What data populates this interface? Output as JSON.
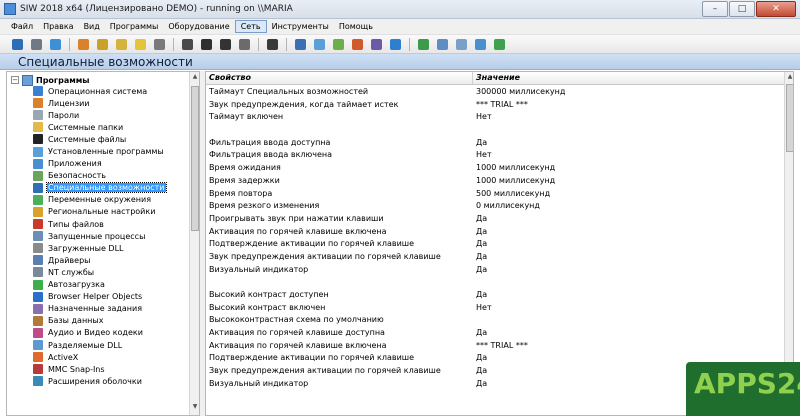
{
  "window": {
    "title": "SIW 2018 x64 (Лицензировано DEMO) - running on \\\\MARIA",
    "minimize": "–",
    "maximize": "□",
    "close": "✕"
  },
  "menu": [
    "Файл",
    "Правка",
    "Вид",
    "Программы",
    "Оборудование",
    "Сеть",
    "Инструменты",
    "Помощь"
  ],
  "toolbar_icons": [
    {
      "name": "save-icon",
      "color": "#2d6fb7"
    },
    {
      "name": "print-icon",
      "color": "#6f7a86"
    },
    {
      "name": "refresh-icon",
      "color": "#3f8ed8"
    },
    {
      "name": "sep"
    },
    {
      "name": "windows-icon",
      "color": "#d9822b"
    },
    {
      "name": "license-icon",
      "color": "#c9a227"
    },
    {
      "name": "key-icon",
      "color": "#d6b33a"
    },
    {
      "name": "bulb-icon",
      "color": "#e3c43a"
    },
    {
      "name": "service-icon",
      "color": "#7a7a7a"
    },
    {
      "name": "sep"
    },
    {
      "name": "cpu-icon",
      "color": "#4a4a4a"
    },
    {
      "name": "display-icon",
      "color": "#2f2f2f"
    },
    {
      "name": "disk-icon",
      "color": "#333333"
    },
    {
      "name": "memory-icon",
      "color": "#6b6b6b"
    },
    {
      "name": "sep"
    },
    {
      "name": "device-icon",
      "color": "#3a3a3a"
    },
    {
      "name": "sep"
    },
    {
      "name": "network-icon",
      "color": "#3b6fb5"
    },
    {
      "name": "monitor-icon",
      "color": "#5aa0d8"
    },
    {
      "name": "battery-icon",
      "color": "#6cae4a"
    },
    {
      "name": "sound-icon",
      "color": "#d05a2b"
    },
    {
      "name": "chip-icon",
      "color": "#6b5aa8"
    },
    {
      "name": "settings-icon",
      "color": "#2f7fd0"
    },
    {
      "name": "sep"
    },
    {
      "name": "share-icon",
      "color": "#3d9a4a"
    },
    {
      "name": "tools-icon",
      "color": "#5f8fc2"
    },
    {
      "name": "mail-icon",
      "color": "#7aa0c8"
    },
    {
      "name": "help-icon",
      "color": "#4a8fd0"
    },
    {
      "name": "money-icon",
      "color": "#3fa050"
    }
  ],
  "header": {
    "title": "Специальные возможности"
  },
  "tree": {
    "root_label": "Программы",
    "items": [
      {
        "label": "Операционная система",
        "icon": "os-icon",
        "color": "#3b7fd1"
      },
      {
        "label": "Лицензии",
        "icon": "license-icon",
        "color": "#d9822b"
      },
      {
        "label": "Пароли",
        "icon": "password-icon",
        "color": "#9aa7b5"
      },
      {
        "label": "Системные папки",
        "icon": "folder-icon",
        "color": "#e2b94a"
      },
      {
        "label": "Системные файлы",
        "icon": "dll-icon",
        "color": "#222222"
      },
      {
        "label": "Установленные программы",
        "icon": "programs-icon",
        "color": "#5aa0d8"
      },
      {
        "label": "Приложения",
        "icon": "apps-icon",
        "color": "#4a8fd0"
      },
      {
        "label": "Безопасность",
        "icon": "security-icon",
        "color": "#6aa35a"
      },
      {
        "label": "Специальные возможности",
        "icon": "accessibility-icon",
        "color": "#2f6fb8"
      },
      {
        "label": "Переменные окружения",
        "icon": "env-icon",
        "color": "#4fae5a"
      },
      {
        "label": "Региональные настройки",
        "icon": "region-icon",
        "color": "#d9a32b"
      },
      {
        "label": "Типы файлов",
        "icon": "file-types-icon",
        "color": "#c93a2b"
      },
      {
        "label": "Запущенные процессы",
        "icon": "process-icon",
        "color": "#6b8fb8"
      },
      {
        "label": "Загруженные DLL",
        "icon": "loaded-dll-icon",
        "color": "#8a8a8a"
      },
      {
        "label": "Драйверы",
        "icon": "driver-icon",
        "color": "#5a7fb0"
      },
      {
        "label": "NT службы",
        "icon": "nt-services-icon",
        "color": "#7a8a9a"
      },
      {
        "label": "Автозагрузка",
        "icon": "startup-icon",
        "color": "#3fae4a"
      },
      {
        "label": "Browser Helper Objects",
        "icon": "bho-icon",
        "color": "#2a6fc9"
      },
      {
        "label": "Назначенные задания",
        "icon": "tasks-icon",
        "color": "#8a6fb0"
      },
      {
        "label": "Базы данных",
        "icon": "database-icon",
        "color": "#b07a3a"
      },
      {
        "label": "Аудио и Видео кодеки",
        "icon": "codec-icon",
        "color": "#c04a8a"
      },
      {
        "label": "Разделяемые DLL",
        "icon": "shared-dll-icon",
        "color": "#5a9ad0"
      },
      {
        "label": "ActiveX",
        "icon": "activex-icon",
        "color": "#e06a2b"
      },
      {
        "label": "MMC Snap-Ins",
        "icon": "mmc-icon",
        "color": "#b83a3a"
      },
      {
        "label": "Расширения оболочки",
        "icon": "shell-icon",
        "color": "#3a8ab8"
      }
    ]
  },
  "list": {
    "col_property": "Свойство",
    "col_value": "Значение",
    "rows": [
      {
        "property": "Таймаут Специальных возможностей",
        "value": "300000 миллисекунд"
      },
      {
        "property": "Звук предупреждения, когда таймает истек",
        "value": "*** TRIAL ***"
      },
      {
        "property": "Таймаут включен",
        "value": "Нет"
      },
      {
        "property": "",
        "value": ""
      },
      {
        "property": "Фильтрация ввода доступна",
        "value": "Да"
      },
      {
        "property": "Фильтрация ввода включена",
        "value": "Нет"
      },
      {
        "property": "Время ожидания",
        "value": "1000 миллисекунд"
      },
      {
        "property": "Время задержки",
        "value": "1000 миллисекунд"
      },
      {
        "property": "Время повтора",
        "value": "500 миллисекунд"
      },
      {
        "property": "Время резкого изменения",
        "value": "0 миллисекунд"
      },
      {
        "property": "Проигрывать звук при нажатии клавиши",
        "value": "Да"
      },
      {
        "property": "Активация по горячей клавише включена",
        "value": "Да"
      },
      {
        "property": "Подтверждение активации по горячей клавише",
        "value": "Да"
      },
      {
        "property": "Звук предупреждения активации по горячей клавише",
        "value": "Да"
      },
      {
        "property": "Визуальный индикатор",
        "value": "Да"
      },
      {
        "property": "",
        "value": ""
      },
      {
        "property": "Высокий контраст доступен",
        "value": "Да"
      },
      {
        "property": "Высокий контраст включен",
        "value": "Нет"
      },
      {
        "property": "Высококонтрастная схема по умолчанию",
        "value": ""
      },
      {
        "property": "Активация по горячей клавише доступна",
        "value": "Да"
      },
      {
        "property": "Активация по горячей клавише включена",
        "value": "*** TRIAL ***"
      },
      {
        "property": "Подтверждение активации по горячей клавише",
        "value": "Да"
      },
      {
        "property": "Звук предупреждения активации по горячей клавише",
        "value": "Да"
      },
      {
        "property": "Визуальный индикатор",
        "value": "Да"
      }
    ]
  },
  "watermark": {
    "text": "APPS24"
  }
}
